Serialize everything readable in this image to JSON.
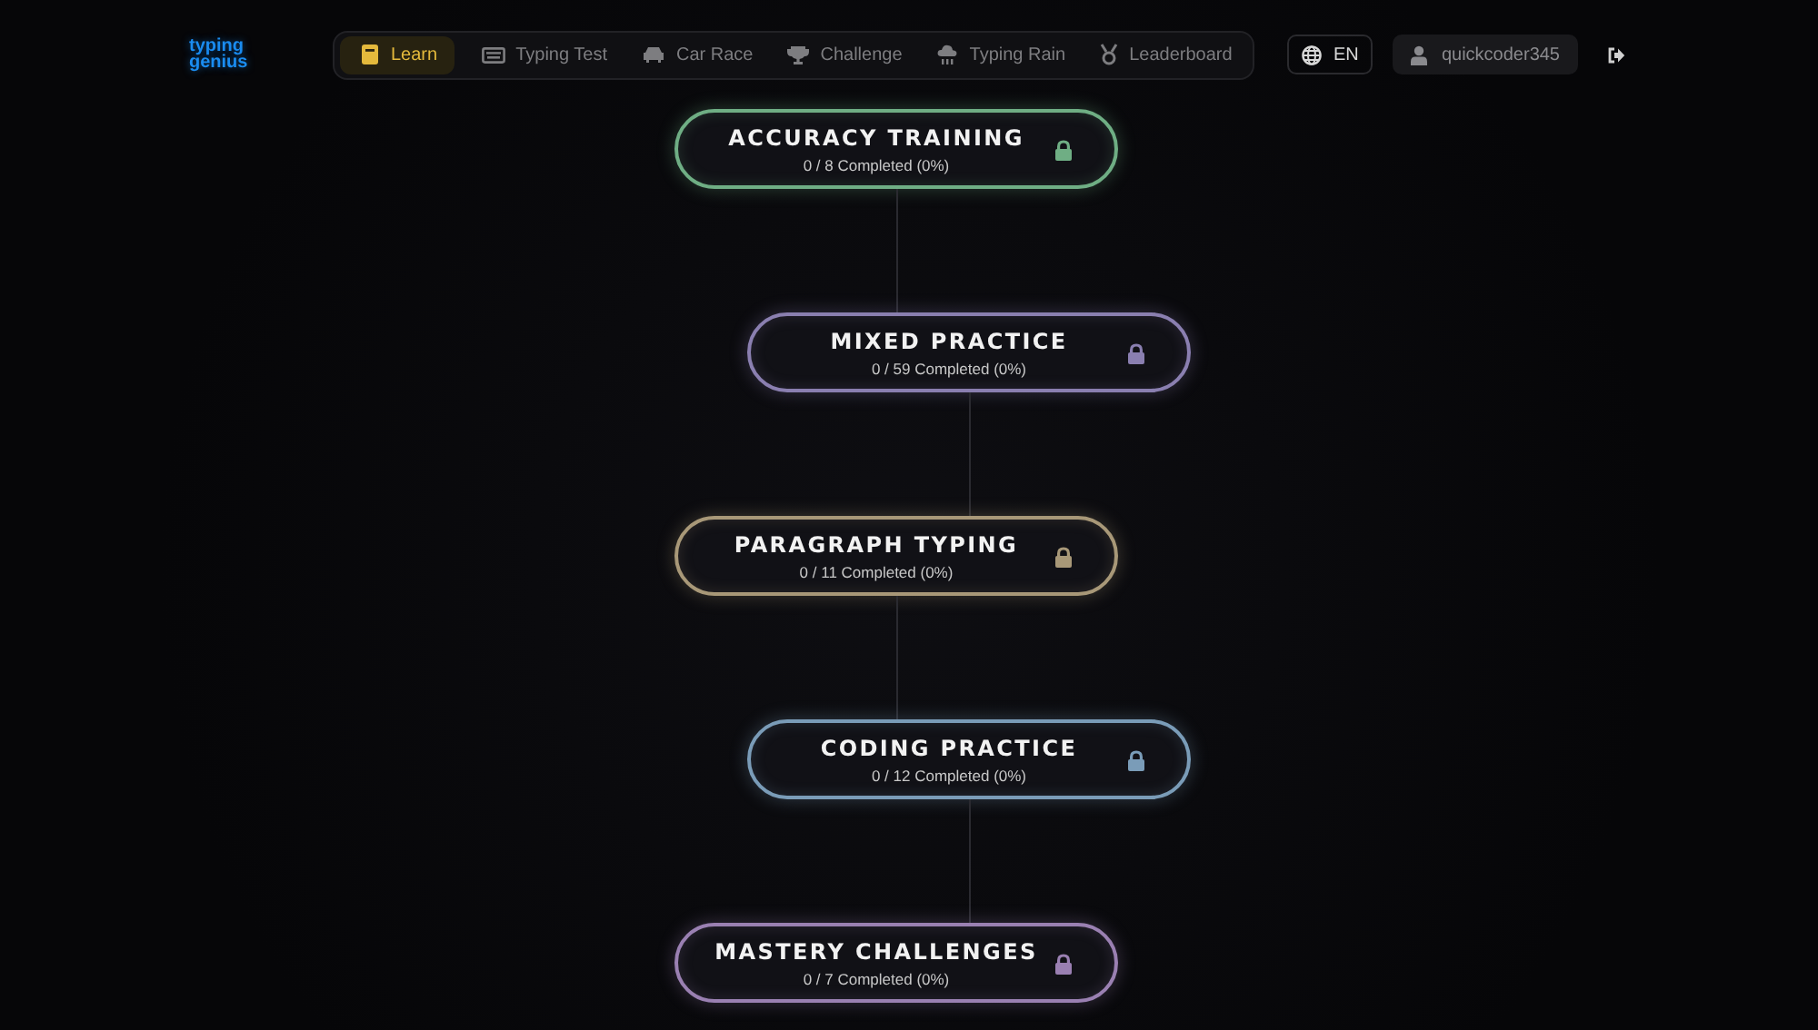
{
  "logo": "typing genius",
  "nav": [
    {
      "label": "Learn",
      "kind": "book",
      "selected": true
    },
    {
      "label": "Typing Test",
      "kind": "keyboard",
      "selected": false
    },
    {
      "label": "Car Race",
      "kind": "car",
      "selected": false
    },
    {
      "label": "Challenge",
      "kind": "trophy",
      "selected": false
    },
    {
      "label": "Typing Rain",
      "kind": "rain",
      "selected": false
    },
    {
      "label": "Leaderboard",
      "kind": "medal",
      "selected": false
    }
  ],
  "language": "EN",
  "user": "quickcoder345",
  "modules": [
    {
      "title": "ACCURACY TRAINING",
      "progress": "0 / 8 Completed (0%)",
      "color": "#6fae84",
      "locked": true
    },
    {
      "title": "MIXED PRACTICE",
      "progress": "0 / 59 Completed (0%)",
      "color": "#8a7fb0",
      "locked": true
    },
    {
      "title": "PARAGRAPH TYPING",
      "progress": "0 / 11 Completed (0%)",
      "color": "#a89878",
      "locked": true
    },
    {
      "title": "CODING PRACTICE",
      "progress": "0 / 12 Completed (0%)",
      "color": "#7a9cb8",
      "locked": true
    },
    {
      "title": "MASTERY CHALLENGES",
      "progress": "0 / 7 Completed (0%)",
      "color": "#9a80b2",
      "locked": true
    }
  ]
}
